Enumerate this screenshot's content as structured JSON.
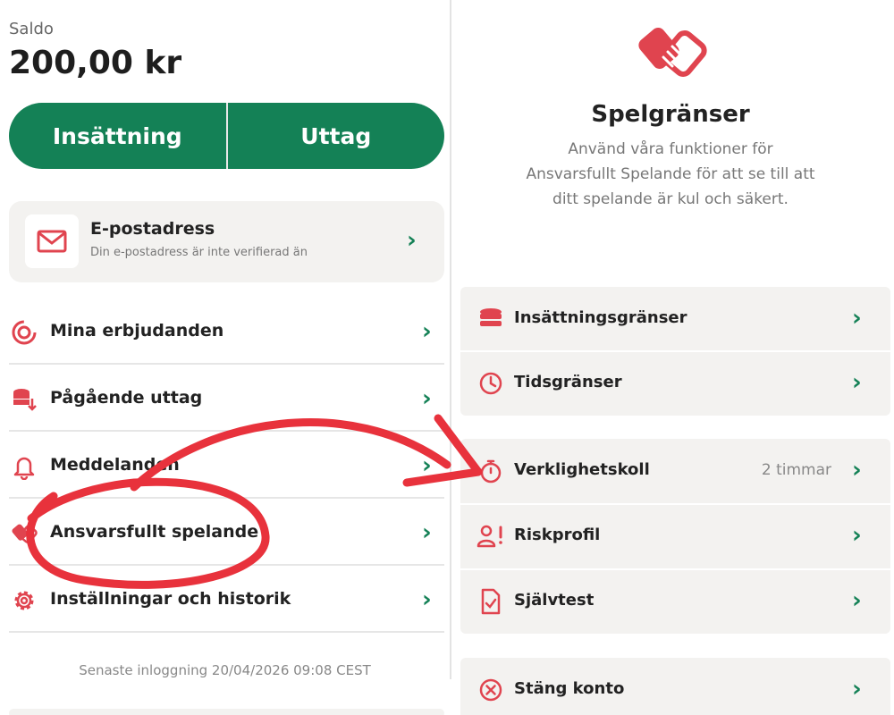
{
  "balance": {
    "label": "Saldo",
    "amount": "200,00 kr"
  },
  "actions": {
    "deposit": "Insättning",
    "withdraw": "Uttag"
  },
  "email_card": {
    "title": "E-postadress",
    "subtitle": "Din e-postadress är inte verifierad än",
    "icon": "mail-icon"
  },
  "menu": [
    {
      "label": "Mina erbjudanden",
      "icon": "offers-ring-icon"
    },
    {
      "label": "Pågående uttag",
      "icon": "coins-withdraw-icon"
    },
    {
      "label": "Meddelanden",
      "icon": "bell-icon"
    },
    {
      "label": "Ansvarsfullt spelande",
      "icon": "handshake-icon"
    },
    {
      "label": "Inställningar och historik",
      "icon": "gear-icon"
    }
  ],
  "last_login": "Senaste inloggning 20/04/2026 09:08 CEST",
  "limits": {
    "title": "Spelgränser",
    "description": "Använd våra funktioner för Ansvarsfullt Spelande för att se till att ditt spelande är kul och säkert.",
    "icon": "handshake-icon",
    "group1": [
      {
        "label": "Insättningsgränser",
        "icon": "coin-stack-icon"
      },
      {
        "label": "Tidsgränser",
        "icon": "clock-icon"
      }
    ],
    "group2": [
      {
        "label": "Verklighetskoll",
        "value": "2 timmar",
        "icon": "stopwatch-icon"
      },
      {
        "label": "Riskprofil",
        "icon": "person-alert-icon"
      },
      {
        "label": "Självtest",
        "icon": "document-check-icon"
      }
    ],
    "group3": [
      {
        "label": "Stäng konto",
        "icon": "close-circle-icon"
      }
    ]
  },
  "colors": {
    "primary_green": "#148156",
    "accent_red": "#e0444f",
    "annotation_red": "#e8323c"
  }
}
